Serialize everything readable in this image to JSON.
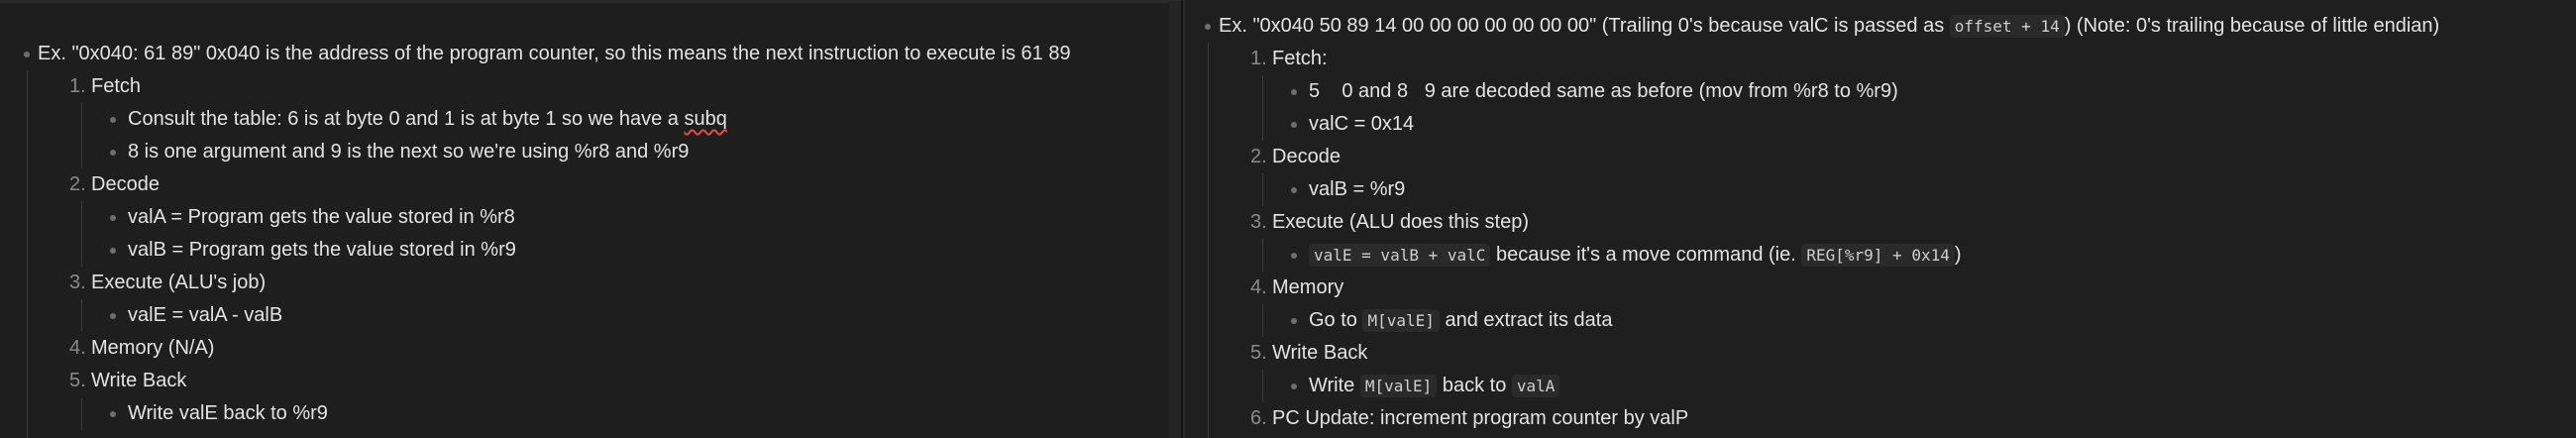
{
  "left": {
    "header": "Ex. \"0x040: 61 89\" 0x040 is the address of the program counter, so this means the next instruction to execute is 61 89",
    "steps": [
      {
        "num": "1.",
        "title": "Fetch",
        "items": [
          {
            "a": "Consult the table: 6 is at byte 0 and 1 is at byte 1 so we have a ",
            "b": "subq"
          },
          {
            "a": "8 is one argument and 9 is the next so we're using %r8 and %r9"
          }
        ]
      },
      {
        "num": "2.",
        "title": "Decode",
        "items": [
          {
            "a": "valA = Program gets the value stored in %r8"
          },
          {
            "a": "valB = Program gets the value stored in %r9"
          }
        ]
      },
      {
        "num": "3.",
        "title": "Execute (ALU's job)",
        "items": [
          {
            "a": "valE = valA - valB"
          }
        ]
      },
      {
        "num": "4.",
        "title": "Memory (N/A)",
        "items": []
      },
      {
        "num": "5.",
        "title": "Write Back",
        "items": [
          {
            "a": "Write valE back to %r9"
          }
        ]
      }
    ]
  },
  "right": {
    "header_a": "Ex. \"0x040 50 89 14 00 00 00 00 00 00 00\" (Trailing 0's because valC is passed as ",
    "header_code": "offset + 14",
    "header_b": ") (Note: 0's trailing because of little endian)",
    "s1_num": "1.",
    "s1_title": "Fetch:",
    "s1_i1": "5    0 and 8   9 are decoded same as before (mov from %r8 to %r9)",
    "s1_i2": "valC = 0x14",
    "s2_num": "2.",
    "s2_title": "Decode",
    "s2_i1": "valB = %r9",
    "s3_num": "3.",
    "s3_title": "Execute (ALU does this step)",
    "s3_code1": "valE = valB + valC",
    "s3_mid": " because it's a move command (ie. ",
    "s3_code2": "REG[%r9] + 0x14",
    "s3_end": ")",
    "s4_num": "4.",
    "s4_title": "Memory",
    "s4_a": "Go to ",
    "s4_code": "M[valE]",
    "s4_b": " and extract its data",
    "s5_num": "5.",
    "s5_title": "Write Back",
    "s5_a": "Write ",
    "s5_code1": "M[valE]",
    "s5_b": " back to ",
    "s5_code2": "valA",
    "s6_num": "6.",
    "s6_title": "PC Update: increment program counter by valP"
  }
}
